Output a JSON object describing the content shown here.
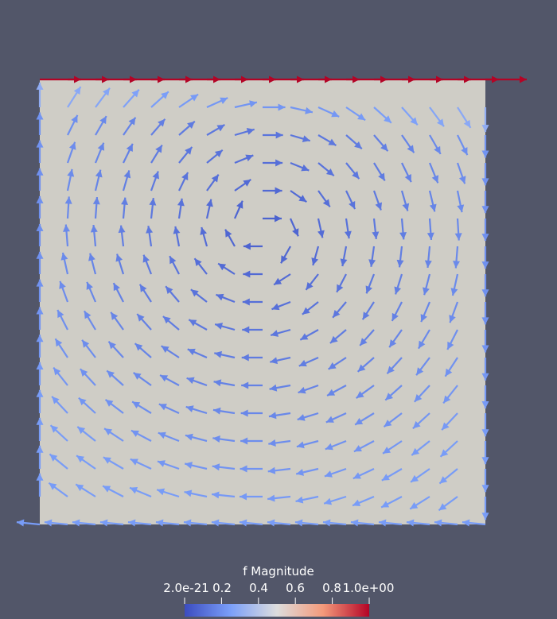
{
  "colorbar": {
    "title": "f Magnitude",
    "ticks": [
      {
        "value": 0.0,
        "label": "2.0e-21"
      },
      {
        "value": 0.2,
        "label": "0.2"
      },
      {
        "value": 0.4,
        "label": "0.4"
      },
      {
        "value": 0.6,
        "label": "0.6"
      },
      {
        "value": 0.8,
        "label": "0.8"
      },
      {
        "value": 1.0,
        "label": "1.0e+00"
      }
    ],
    "range": [
      0,
      1
    ],
    "colors": {
      "low": "#3b4cc0",
      "mid": "#dddddd",
      "high": "#b40426"
    }
  },
  "colors": {
    "background": "#525669",
    "domain": "#cfcdc6"
  }
}
